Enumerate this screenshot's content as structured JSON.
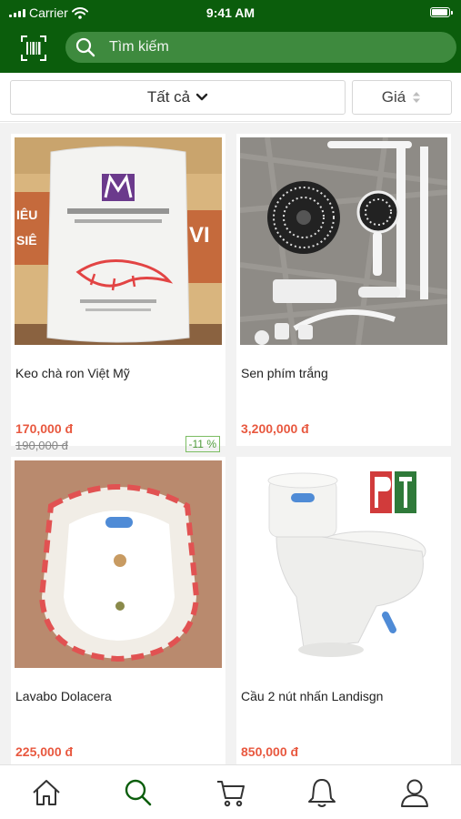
{
  "status_bar": {
    "carrier": "Carrier",
    "time": "9:41 AM",
    "battery_level": 1.0
  },
  "header": {
    "search_placeholder": "Tìm kiếm",
    "brand_color": "#0b5d0c",
    "search_bg": "#3e8a3e"
  },
  "filter": {
    "category_label": "Tất cả",
    "sort_label": "Giá"
  },
  "products": [
    {
      "name": "Keo chà ron Việt Mỹ",
      "price": "170,000 đ",
      "old_price": "190,000 đ",
      "discount": "-11 %"
    },
    {
      "name": "Sen phím trắng",
      "price": "3,200,000 đ"
    },
    {
      "name": "Lavabo Dolacera",
      "price": "225,000 đ"
    },
    {
      "name": "Cầu 2 nút nhấn Landisgn",
      "price": "850,000 đ"
    }
  ],
  "icons": {
    "header": [
      "barcode-scan-icon",
      "search-icon"
    ],
    "tabs": [
      "home-icon",
      "search-icon",
      "cart-icon",
      "bell-icon",
      "user-icon"
    ]
  },
  "colors": {
    "price": "#e8583f",
    "discount_border": "#7cbd63",
    "active_tab": "#0b5d0c"
  }
}
